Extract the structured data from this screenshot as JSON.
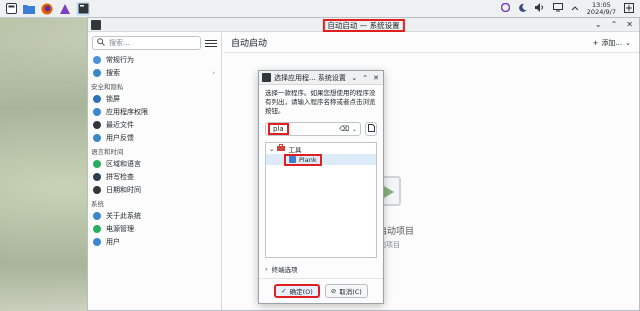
{
  "taskbar": {
    "clock_time": "13:05",
    "clock_date": "2024/9/7"
  },
  "window": {
    "title": "自动启动 — 系统设置"
  },
  "sidebar": {
    "search_placeholder": "搜索...",
    "items": [
      {
        "type": "item",
        "label": "常规行为",
        "color": "#4a90d9"
      },
      {
        "type": "item",
        "label": "搜索",
        "color": "#3b88c8",
        "chevron": true
      },
      {
        "type": "section",
        "label": "安全和隐私"
      },
      {
        "type": "item",
        "label": "锁屏",
        "color": "#2e73b8"
      },
      {
        "type": "item",
        "label": "应用程序权限",
        "color": "#3a88d4"
      },
      {
        "type": "item",
        "label": "最近文件",
        "color": "#31363b"
      },
      {
        "type": "item",
        "label": "用户反馈",
        "color": "#3b88c8"
      },
      {
        "type": "section",
        "label": "语言和时间"
      },
      {
        "type": "item",
        "label": "区域和语言",
        "color": "#27ae60"
      },
      {
        "type": "item",
        "label": "拼写检查",
        "color": "#2c3e50"
      },
      {
        "type": "item",
        "label": "日期和时间",
        "color": "#31363b"
      },
      {
        "type": "section",
        "label": "系统"
      },
      {
        "type": "item",
        "label": "关于此系统",
        "color": "#3b88c8"
      },
      {
        "type": "item",
        "label": "电源管理",
        "color": "#27ae60"
      },
      {
        "type": "item",
        "label": "用户",
        "color": "#3a88d4"
      }
    ]
  },
  "content": {
    "title": "自动启动",
    "add_label": "添加...",
    "empty_title": "的自动启动项目",
    "empty_sub": "按钮以添加项目"
  },
  "dialog": {
    "title": "选择应用程... 系统设置",
    "description": "选择一款程序。如果您想使用的程序没有列出，请输入程序名称或者点击浏览按钮。",
    "input_value": "pla",
    "category_label": "工具",
    "app_label": "Plank",
    "terminal_option": "终端选项",
    "ok_label": "确定(O)",
    "cancel_label": "取消(C)"
  }
}
